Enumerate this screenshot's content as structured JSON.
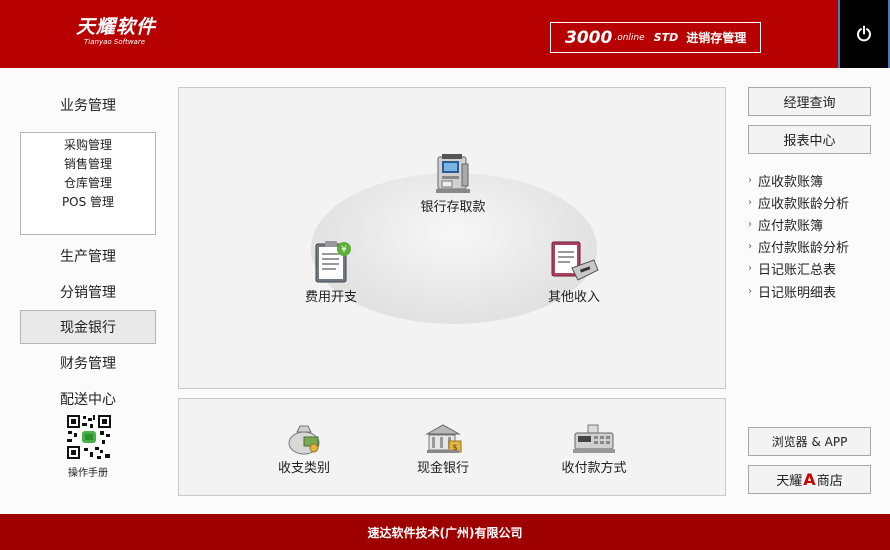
{
  "header": {
    "logo_text": "天耀软件",
    "logo_sub": "Tianyao Software",
    "product_num": "3000",
    "product_online": ".online",
    "product_edition": "STD",
    "product_name": "进销存管理"
  },
  "nav": {
    "items": [
      {
        "label": "业务管理"
      },
      {
        "label": "生产管理"
      },
      {
        "label": "分销管理"
      },
      {
        "label": "现金银行"
      },
      {
        "label": "财务管理"
      },
      {
        "label": "配送中心"
      }
    ],
    "active": "现金银行",
    "submenu": [
      "采购管理",
      "销售管理",
      "仓库管理",
      "POS 管理"
    ],
    "manual_label": "操作手册"
  },
  "main_panel": {
    "items": [
      {
        "label": "银行存取款",
        "icon": "atm-icon"
      },
      {
        "label": "费用开支",
        "icon": "expense-clipboard-icon"
      },
      {
        "label": "其他收入",
        "icon": "income-terminal-icon"
      }
    ]
  },
  "bottom_panel": {
    "items": [
      {
        "label": "收支类别",
        "icon": "money-bag-icon"
      },
      {
        "label": "现金银行",
        "icon": "bank-icon"
      },
      {
        "label": "收付款方式",
        "icon": "cash-register-icon"
      }
    ]
  },
  "right": {
    "top_buttons": [
      "经理查询",
      "报表中心"
    ],
    "links": [
      "应收款账簿",
      "应收款账龄分析",
      "应付款账簿",
      "应付款账龄分析",
      "日记账汇总表",
      "日记账明细表"
    ],
    "browser_btn": "浏览器 & APP",
    "store_btn_pre": "天耀",
    "store_btn_mark": "A",
    "store_btn_post": "商店"
  },
  "footer": {
    "company": "速达软件技术(广州)有限公司"
  },
  "colors": {
    "header_red": "#b70000",
    "footer_red": "#9e0000",
    "store_mark_red": "#cc0000"
  }
}
